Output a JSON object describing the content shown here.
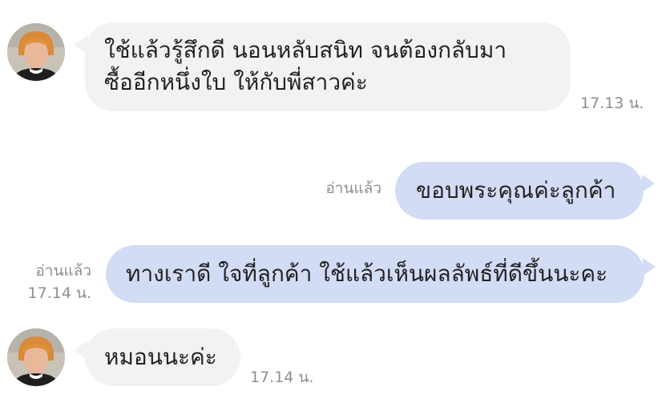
{
  "messages": [
    {
      "id": "m1",
      "direction": "incoming",
      "lines": [
        "ใช้แล้วรู้สึกดี นอนหลับสนิท จนต้องกลับมา",
        "ซื้ออีกหนึ่งใบ ให้กับพี่สาวค่ะ"
      ],
      "time": "17.13 น."
    },
    {
      "id": "m2",
      "direction": "outgoing",
      "text": "ขอบพระคุณค่ะลูกค้า",
      "read": "อ่านแล้ว"
    },
    {
      "id": "m3",
      "direction": "outgoing",
      "text": "ทางเราดี ใจที่ลูกค้า ใช้แล้วเห็นผลลัพธ์ที่ดีขึ้นนะคะ",
      "read": "อ่านแล้ว",
      "time": "17.14 น."
    },
    {
      "id": "m4",
      "direction": "incoming",
      "text": "หมอนนะค่ะ",
      "time": "17.14 น."
    }
  ],
  "colors": {
    "incoming_bubble": "#f1f2f4",
    "outgoing_bubble": "#d3dcf5",
    "meta_text": "#8e8e93"
  },
  "icons": {
    "avatar": "user-photo-avatar"
  }
}
